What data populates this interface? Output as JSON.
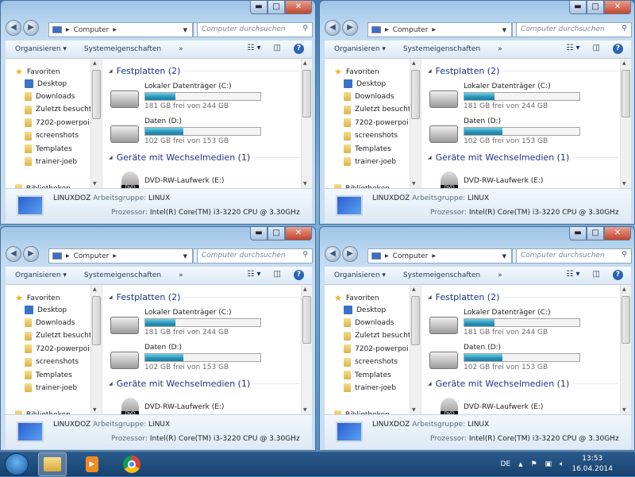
{
  "window": {
    "caption_buttons": {
      "minimize": "▬",
      "maximize": "□",
      "close": "✕"
    },
    "address": {
      "location": "Computer",
      "icon": "computer-icon"
    },
    "search_placeholder": "Computer durchsuchen",
    "toolbar": {
      "organize": "Organisieren ▾",
      "system_properties": "Systemeigenschaften",
      "more": "»",
      "help": "?"
    },
    "sidebar": {
      "favorites": "Favoriten",
      "items": [
        "Desktop",
        "Downloads",
        "Zuletzt besucht",
        "7202-powerpoi",
        "screenshots",
        "Templates",
        "trainer-joeb"
      ],
      "libraries": "Bibliotheken"
    },
    "groups": {
      "hard_disks": "Festplatten (2)",
      "removable": "Geräte mit Wechselmedien (1)"
    },
    "drives": [
      {
        "name": "Lokaler Datenträger (C:)",
        "free_text": "181 GB frei von 244 GB",
        "used_percent": 26
      },
      {
        "name": "Daten (D:)",
        "free_text": "102 GB frei von 153 GB",
        "used_percent": 33
      }
    ],
    "dvd": {
      "name": "DVD-RW-Laufwerk (E:)",
      "badge": "DVD"
    },
    "details": {
      "computer_name": "LINUXDOZ",
      "workgroup_label": "Arbeitsgruppe:",
      "workgroup": "LINUX",
      "processor_label": "Prozessor:",
      "processor": "Intel(R) Core(TM) i3-3220 CPU @ 3.30GHz"
    }
  },
  "taskbar": {
    "language": "DE",
    "time": "13:53",
    "date": "16.04.2014",
    "pinned": [
      "windows-explorer",
      "media-player",
      "chrome"
    ]
  }
}
